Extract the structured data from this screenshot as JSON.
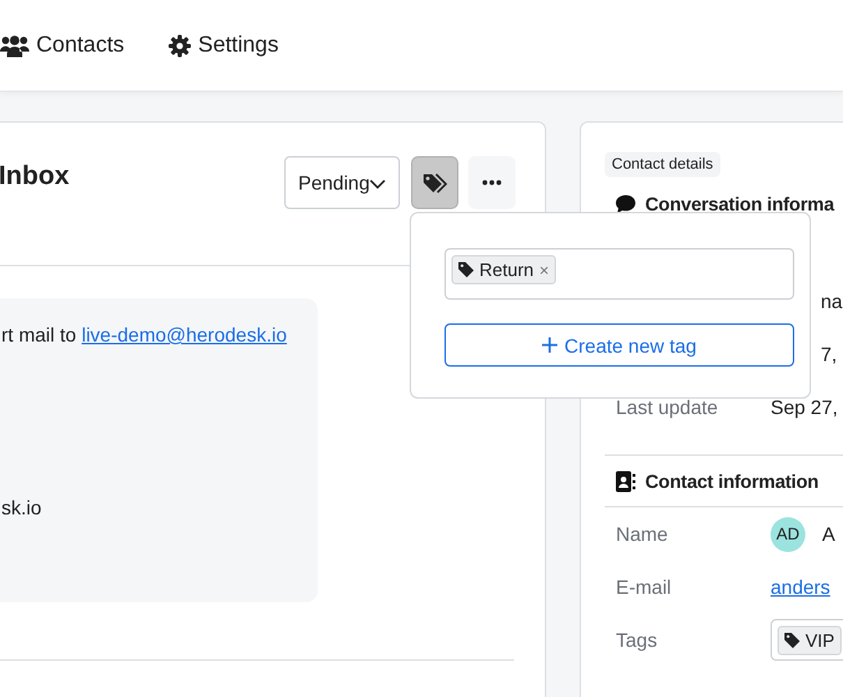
{
  "nav": [
    {
      "label": "Contacts"
    },
    {
      "label": "Settings"
    }
  ],
  "conversation": {
    "title": "Inbox",
    "status": "Pending",
    "tag_button": {
      "selected": true
    },
    "message": [
      {
        "text": "rt mail to",
        "link": "live-demo@herodesk.io"
      },
      {
        "text": "sk.io"
      }
    ]
  },
  "tag_popup": {
    "tags": [
      {
        "label": "Return",
        "remove": "×"
      }
    ],
    "create_button": "Create new tag"
  },
  "details": {
    "badge": "Contact details",
    "conversation_heading": "Conversation informa",
    "conversation_rows": [
      {
        "value": "na"
      },
      {
        "value": "7,"
      },
      {
        "label": "Last update",
        "value": "Sep 27,"
      }
    ],
    "contact_heading": "Contact information",
    "contact_rows": [
      {
        "kind": "avatar",
        "label": "Name",
        "initials": "AD",
        "value": "A"
      },
      {
        "kind": "link",
        "label": "E-mail",
        "value": "anders"
      },
      {
        "kind": "tags",
        "label": "Tags",
        "tags": [
          {
            "label": "VIP"
          }
        ]
      }
    ]
  }
}
